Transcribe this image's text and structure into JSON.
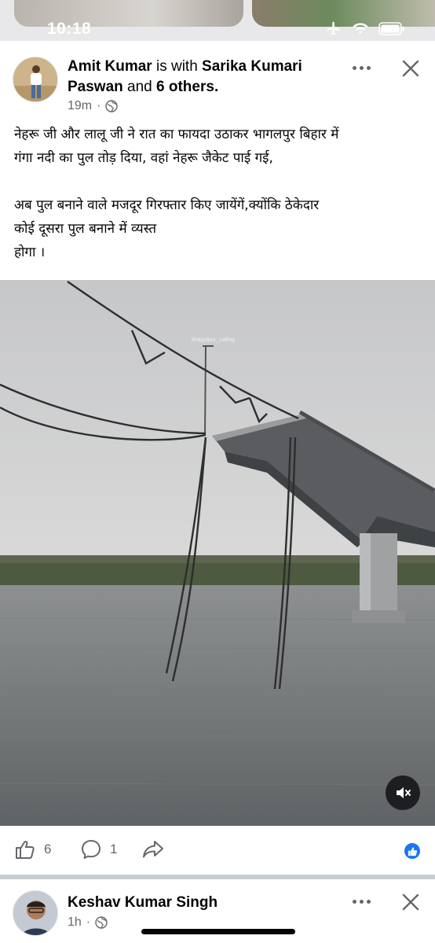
{
  "status_bar": {
    "time": "10:18",
    "icons": [
      "airplane-icon",
      "wifi-icon",
      "battery-icon"
    ]
  },
  "post": {
    "author": "Amit Kumar",
    "with_text": "is with",
    "tagged": "Sarika Kumari Paswan",
    "and_text": "and",
    "others": "6 others.",
    "time": "19m",
    "privacy_icon": "globe-icon",
    "text_lines": [
      "नेहरू जी और लालू जी ने रात का फायदा उठाकर भागलपुर बिहार में",
      "गंगा नदी का पुल तोड़ दिया, वहां नेहरू जैकेट पाई गई,",
      "अब पुल बनाने वाले मजदूर गिरफ्तार किए जायेंगें,क्योंकि ठेकेदार",
      "कोई दूसरा पुल बनाने में व्यस्त",
      "होगा ।"
    ],
    "media_watermark": "bhagalpur_calling",
    "like_count": "6",
    "comment_count": "1",
    "reaction_icon": "like-reaction-icon"
  },
  "next_post": {
    "author": "Keshav Kumar Singh",
    "time": "1h",
    "privacy_icon": "globe-icon"
  },
  "colors": {
    "text": "#050505",
    "secondary": "#65676b",
    "facebook_blue": "#1877f2",
    "divider": "#c9ccd1"
  }
}
